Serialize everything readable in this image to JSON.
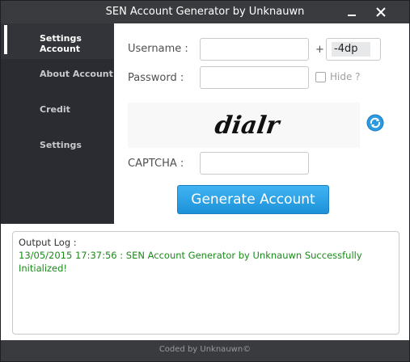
{
  "window": {
    "title": "SEN Account Generator by Unknauwn",
    "minimize_icon": "minimize-icon",
    "close_icon": "close-icon"
  },
  "sidebar": {
    "items": [
      {
        "label": "Settings Account",
        "active": true
      },
      {
        "label": "About Account",
        "active": false
      },
      {
        "label": "Credit",
        "active": false
      },
      {
        "label": "Settings",
        "active": false
      }
    ]
  },
  "form": {
    "username_label": "Username :",
    "username_value": "",
    "plus": "+",
    "suffix_value": "-4dp",
    "password_label": "Password :",
    "password_value": "",
    "hide_label": "Hide ?",
    "hide_checked": false,
    "captcha_text": "dialr",
    "captcha_label": "CAPTCHA :",
    "captcha_value": "",
    "refresh_icon": "refresh-icon",
    "generate_label": "Generate Account"
  },
  "log": {
    "title": "Output Log :",
    "message": "13/05/2015 17:37:56 : SEN Account Generator by Unknauwn Successfully Initialized!"
  },
  "footer": {
    "text": "Coded by Unknauwn©"
  },
  "colors": {
    "background": "#3a3b3f",
    "sidebar": "#2b2c31",
    "accent": "#1e92d9",
    "log_text": "#1a8a1a"
  }
}
